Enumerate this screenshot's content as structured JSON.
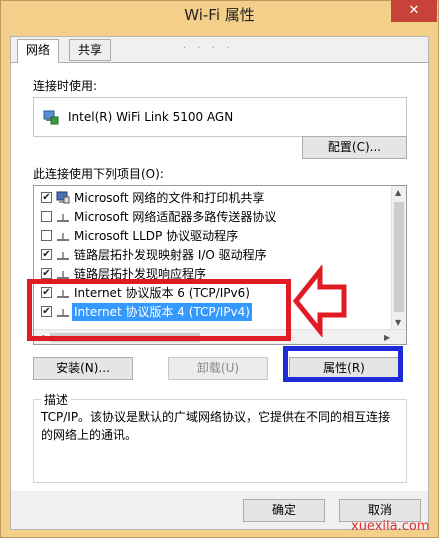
{
  "window": {
    "title": "Wi-Fi 属性",
    "close_glyph": "✕"
  },
  "tabs": [
    {
      "label": "网络",
      "active": true
    },
    {
      "label": "共享",
      "active": false
    }
  ],
  "connect_using": {
    "label": "连接时使用:",
    "adapter_name": "Intel(R) WiFi Link 5100 AGN",
    "configure_button": "配置(C)..."
  },
  "items_section": {
    "label": "此连接使用下列项目(O):",
    "items": [
      {
        "checked": true,
        "icon": "network-share-icon",
        "text": "Microsoft 网络的文件和打印机共享",
        "selected": false
      },
      {
        "checked": false,
        "icon": "protocol-icon",
        "text": "Microsoft 网络适配器多路传送器协议",
        "selected": false
      },
      {
        "checked": false,
        "icon": "protocol-icon",
        "text": "Microsoft LLDP 协议驱动程序",
        "selected": false
      },
      {
        "checked": true,
        "icon": "protocol-icon",
        "text": "链路层拓扑发现映射器 I/O 驱动程序",
        "selected": false
      },
      {
        "checked": true,
        "icon": "protocol-icon",
        "text": "链路层拓扑发现响应程序",
        "selected": false
      },
      {
        "checked": true,
        "icon": "protocol-icon",
        "text": "Internet 协议版本 6 (TCP/IPv6)",
        "selected": false
      },
      {
        "checked": true,
        "icon": "protocol-icon",
        "text": "Internet 协议版本 4 (TCP/IPv4)",
        "selected": true
      }
    ],
    "check_glyph": "✔"
  },
  "buttons": {
    "install": "安装(N)...",
    "uninstall": "卸载(U)",
    "properties": "属性(R)"
  },
  "description": {
    "title": "描述",
    "text": "TCP/IP。该协议是默认的广域网络协议，它提供在不同的相互连接的网络上的通讯。"
  },
  "footer": {
    "ok": "确定",
    "cancel": "取消"
  },
  "watermark": "xuexila.com",
  "colors": {
    "highlight_red": "#e01b24",
    "highlight_blue": "#1e2bd8",
    "selection": "#3399ff",
    "close_button": "#c7433a"
  }
}
